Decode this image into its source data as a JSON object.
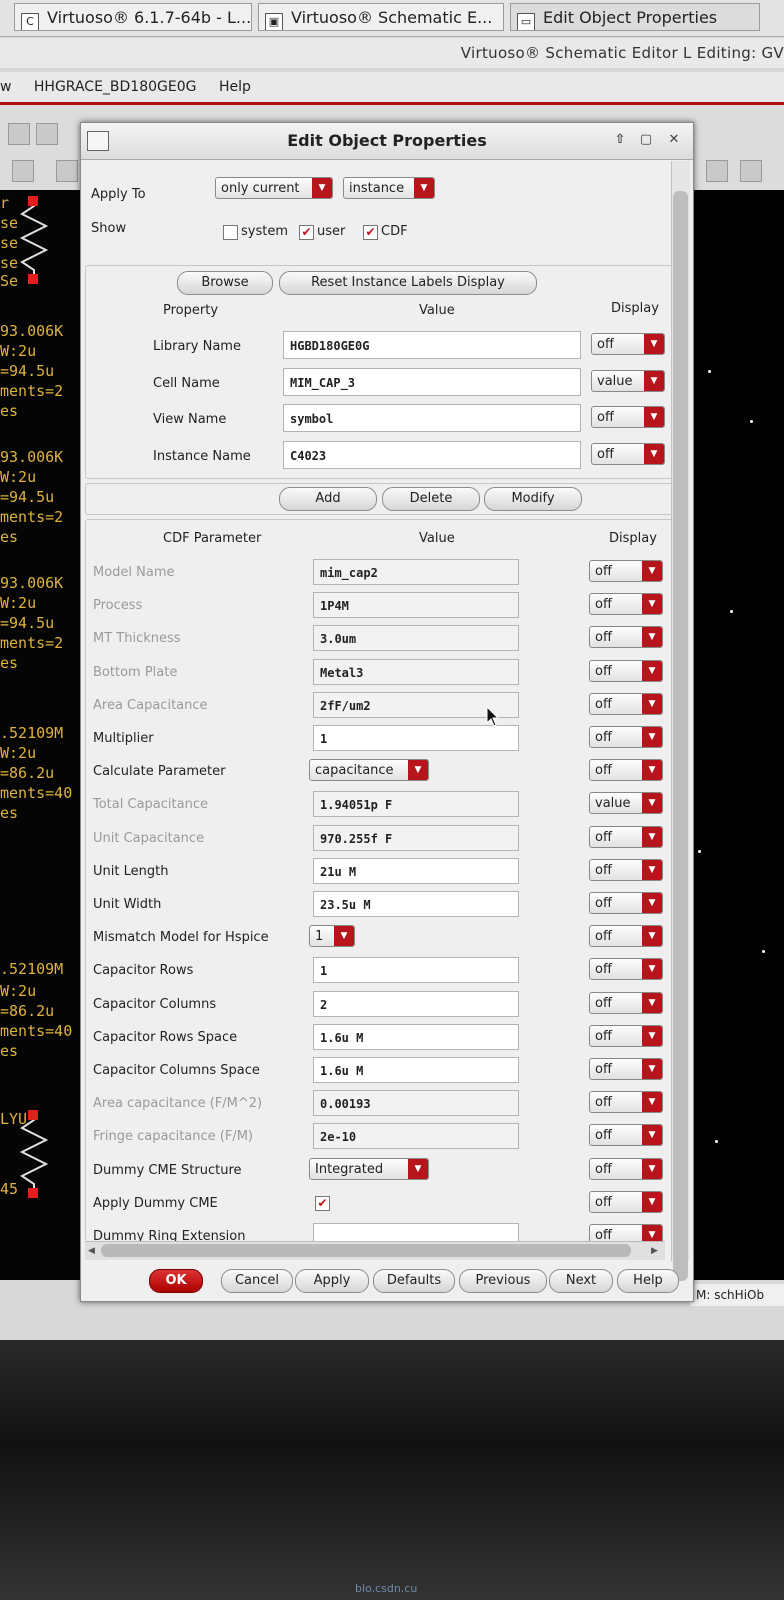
{
  "taskbar": {
    "tabs": [
      {
        "label": "Virtuoso® 6.1.7-64b - L..."
      },
      {
        "label": "Virtuoso® Schematic E..."
      },
      {
        "label": "Edit Object Properties"
      }
    ]
  },
  "window_title": "Virtuoso® Schematic Editor L Editing: GV",
  "menubar": {
    "items": [
      {
        "label": "w"
      },
      {
        "label": "HHGRACE_BD180GE0G"
      },
      {
        "label": "Help"
      }
    ]
  },
  "canvas_left_text": [
    "r",
    "se",
    "se",
    "se",
    "Se",
    "93.006K",
    "W:2u",
    "=94.5u",
    "ments=2",
    "es",
    "93.006K",
    "W:2u",
    "=94.5u",
    "ments=2",
    "es",
    "93.006K",
    "W:2u",
    "=94.5u",
    "ments=2",
    "es",
    ".52109M",
    "W:2u",
    "=86.2u",
    "ments=40",
    "es",
    ".52109M",
    "W:2u",
    "=86.2u",
    "ments=40",
    "es",
    "LYU",
    "45"
  ],
  "status_right": "M: schHiOb",
  "watermark": "blo.csdn.cu",
  "dialog": {
    "title": "Edit Object Properties",
    "apply_to_label": "Apply To",
    "apply_to_scope": "only current",
    "apply_to_type": "instance",
    "show_label": "Show",
    "show_options": [
      {
        "label": "system",
        "checked": false
      },
      {
        "label": "user",
        "checked": true
      },
      {
        "label": "CDF",
        "checked": true
      }
    ],
    "browse_label": "Browse",
    "reset_label": "Reset Instance Labels Display",
    "prop_headers": {
      "property": "Property",
      "value": "Value",
      "display": "Display"
    },
    "properties": [
      {
        "name": "Library Name",
        "value": "HGBD180GE0G",
        "display": "off"
      },
      {
        "name": "Cell Name",
        "value": "MIM_CAP_3",
        "display": "value"
      },
      {
        "name": "View Name",
        "value": "symbol",
        "display": "off"
      },
      {
        "name": "Instance Name",
        "value": "C4023",
        "display": "off"
      }
    ],
    "add_label": "Add",
    "delete_label": "Delete",
    "modify_label": "Modify",
    "cdf_headers": {
      "param": "CDF Parameter",
      "value": "Value",
      "display": "Display"
    },
    "cdf_params": [
      {
        "name": "Model Name",
        "kind": "field",
        "value": "mim_cap2",
        "enabled": false,
        "display": "off"
      },
      {
        "name": "Process",
        "kind": "field",
        "value": "1P4M",
        "enabled": false,
        "display": "off"
      },
      {
        "name": "MT Thickness",
        "kind": "field",
        "value": "3.0um",
        "enabled": false,
        "display": "off"
      },
      {
        "name": "Bottom Plate",
        "kind": "field",
        "value": "Metal3",
        "enabled": false,
        "display": "off"
      },
      {
        "name": "Area Capacitance",
        "kind": "field",
        "value": "2fF/um2",
        "enabled": false,
        "display": "off"
      },
      {
        "name": "Multiplier",
        "kind": "field",
        "value": "1",
        "enabled": true,
        "display": "off"
      },
      {
        "name": "Calculate Parameter",
        "kind": "combo",
        "value": "capacitance",
        "enabled": true,
        "display": "off"
      },
      {
        "name": "Total Capacitance",
        "kind": "field",
        "value": "1.94051p F",
        "enabled": false,
        "display": "value"
      },
      {
        "name": "Unit Capacitance",
        "kind": "field",
        "value": "970.255f F",
        "enabled": false,
        "display": "off"
      },
      {
        "name": "Unit Length",
        "kind": "field",
        "value": "21u M",
        "enabled": true,
        "display": "off"
      },
      {
        "name": "Unit Width",
        "kind": "field",
        "value": "23.5u M",
        "enabled": true,
        "display": "off"
      },
      {
        "name": "Mismatch Model for Hspice",
        "kind": "combo-small",
        "value": "1",
        "enabled": true,
        "display": "off"
      },
      {
        "name": "Capacitor Rows",
        "kind": "field",
        "value": "1",
        "enabled": true,
        "display": "off"
      },
      {
        "name": "Capacitor Columns",
        "kind": "field",
        "value": "2",
        "enabled": true,
        "display": "off"
      },
      {
        "name": "Capacitor Rows Space",
        "kind": "field",
        "value": "1.6u M",
        "enabled": true,
        "display": "off"
      },
      {
        "name": "Capacitor Columns Space",
        "kind": "field",
        "value": "1.6u M",
        "enabled": true,
        "display": "off"
      },
      {
        "name": "Area capacitance (F/M^2)",
        "kind": "field",
        "value": "0.00193",
        "enabled": false,
        "display": "off"
      },
      {
        "name": "Fringe capacitance (F/M)",
        "kind": "field",
        "value": "2e-10",
        "enabled": false,
        "display": "off"
      },
      {
        "name": "Dummy CME Structure",
        "kind": "combo",
        "value": "Integrated",
        "enabled": true,
        "display": "off"
      },
      {
        "name": "Apply Dummy CME",
        "kind": "check",
        "value": "",
        "checked": true,
        "enabled": true,
        "display": "off"
      },
      {
        "name": "Dummy Ring Extension",
        "kind": "field",
        "value": "",
        "enabled": true,
        "display": "off"
      }
    ],
    "footer_buttons": [
      {
        "label": "OK"
      },
      {
        "label": "Cancel"
      },
      {
        "label": "Apply"
      },
      {
        "label": "Defaults"
      },
      {
        "label": "Previous"
      },
      {
        "label": "Next"
      },
      {
        "label": "Help"
      }
    ]
  }
}
